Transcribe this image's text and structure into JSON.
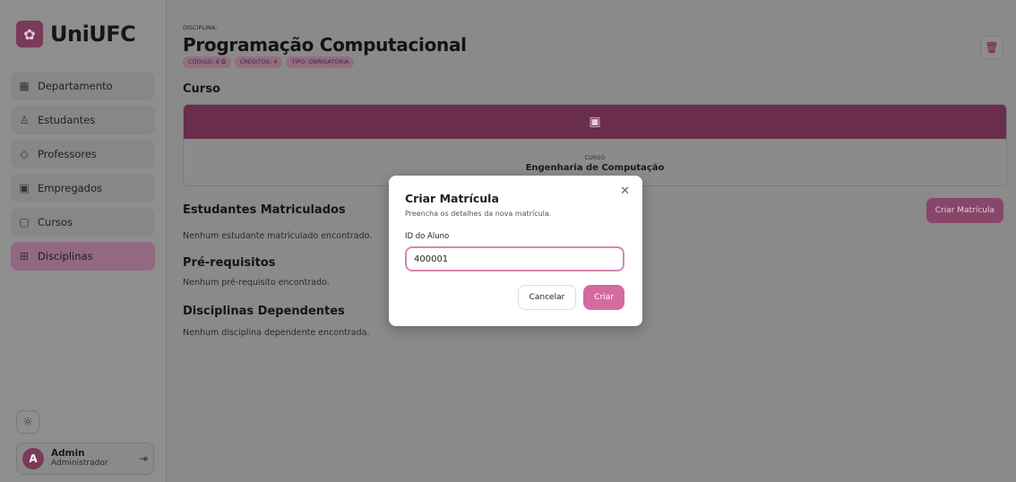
{
  "brand": {
    "name": "UniUFC",
    "logo_icon": "graduation-flower-icon"
  },
  "sidebar": {
    "items": [
      {
        "label": "Departamento",
        "icon": "building-icon",
        "active": false
      },
      {
        "label": "Estudantes",
        "icon": "user-icon",
        "active": false
      },
      {
        "label": "Professores",
        "icon": "graduation-cap-icon",
        "active": false
      },
      {
        "label": "Empregados",
        "icon": "id-badge-icon",
        "active": false
      },
      {
        "label": "Cursos",
        "icon": "book-icon",
        "active": false
      },
      {
        "label": "Disciplinas",
        "icon": "grid-icon",
        "active": true
      }
    ],
    "theme_icon": "sun-icon",
    "user": {
      "initial": "A",
      "name": "Admin",
      "role": "Administrador",
      "logout_icon": "logout-icon"
    }
  },
  "header": {
    "overline": "DISCIPLINA:",
    "title": "Programação Computacional",
    "tags": {
      "codigo": "CÓDIGO: 6 ⧉",
      "creditos": "CRÉDITOS: 4",
      "tipo": "TIPO: OBRIGATÓRIA"
    },
    "delete_icon": "trash-icon"
  },
  "course": {
    "section_title": "Curso",
    "label": "CURSO",
    "name": "Engenharia de Computação",
    "icon": "book-icon"
  },
  "sections": {
    "estudantes": {
      "title": "Estudantes Matriculados",
      "empty": "Nenhum estudante matriculado encontrado.",
      "action": "Criar Matrícula"
    },
    "prerequisitos": {
      "title": "Pré-requisitos",
      "empty": "Nenhum pré-requisito encontrado."
    },
    "dependentes": {
      "title": "Disciplinas Dependentes",
      "empty": "Nenhum disciplina dependente encontrada."
    }
  },
  "modal": {
    "title": "Criar Matrícula",
    "description": "Preencha os detalhes da nova matrícula.",
    "field_label": "ID do Aluno",
    "field_value": "400001",
    "cancel_label": "Cancelar",
    "create_label": "Criar",
    "close_icon": "close-icon"
  },
  "colors": {
    "accent": "#d46aa0",
    "course_header": "#6a2d4c",
    "active_nav": "#926882"
  }
}
